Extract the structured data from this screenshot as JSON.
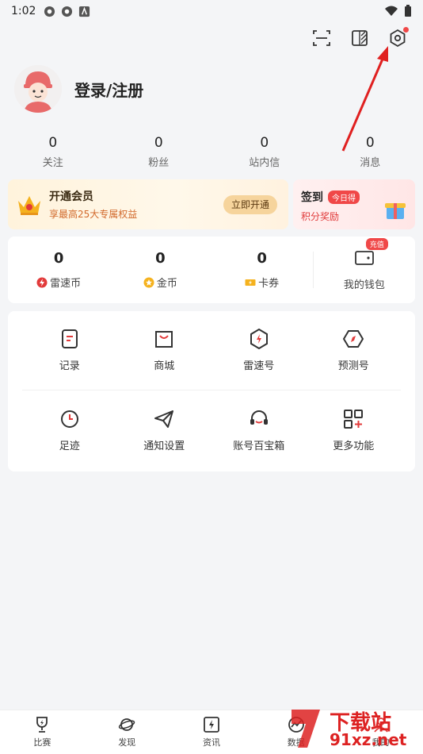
{
  "status": {
    "time": "1:02"
  },
  "header": {
    "icons": [
      "scan-icon",
      "theme-icon",
      "settings-icon"
    ]
  },
  "profile": {
    "login_label": "登录/注册"
  },
  "stats": [
    {
      "value": "0",
      "label": "关注"
    },
    {
      "value": "0",
      "label": "粉丝"
    },
    {
      "value": "0",
      "label": "站内信"
    },
    {
      "value": "0",
      "label": "消息"
    }
  ],
  "vip": {
    "title": "开通会员",
    "subtitle": "享最高25大专属权益",
    "button": "立即开通"
  },
  "signin": {
    "title": "签到",
    "badge": "今日得",
    "subtitle": "积分奖励"
  },
  "wallet": {
    "items": [
      {
        "value": "0",
        "label": "雷速币"
      },
      {
        "value": "0",
        "label": "金币"
      },
      {
        "value": "0",
        "label": "卡券"
      }
    ],
    "purse_label": "我的钱包",
    "recharge_badge": "充值"
  },
  "grid": {
    "row1": [
      {
        "label": "记录",
        "icon": "record-icon"
      },
      {
        "label": "商城",
        "icon": "shop-icon"
      },
      {
        "label": "雷速号",
        "icon": "leisu-icon"
      },
      {
        "label": "预测号",
        "icon": "predict-icon"
      }
    ],
    "row2": [
      {
        "label": "足迹",
        "icon": "history-icon"
      },
      {
        "label": "通知设置",
        "icon": "notify-icon"
      },
      {
        "label": "账号百宝箱",
        "icon": "service-icon"
      },
      {
        "label": "更多功能",
        "icon": "more-icon"
      }
    ]
  },
  "tabs": [
    {
      "label": "比赛",
      "icon": "trophy-icon"
    },
    {
      "label": "发现",
      "icon": "planet-icon"
    },
    {
      "label": "资讯",
      "icon": "news-icon"
    },
    {
      "label": "数据",
      "icon": "data-icon"
    },
    {
      "label": "我的",
      "icon": "me-icon"
    }
  ],
  "watermark": {
    "line1": "下载站",
    "line2": "91xz.net"
  },
  "colors": {
    "accent": "#f04848",
    "vip_gold": "#f6d49c",
    "arrow": "#e02020"
  }
}
